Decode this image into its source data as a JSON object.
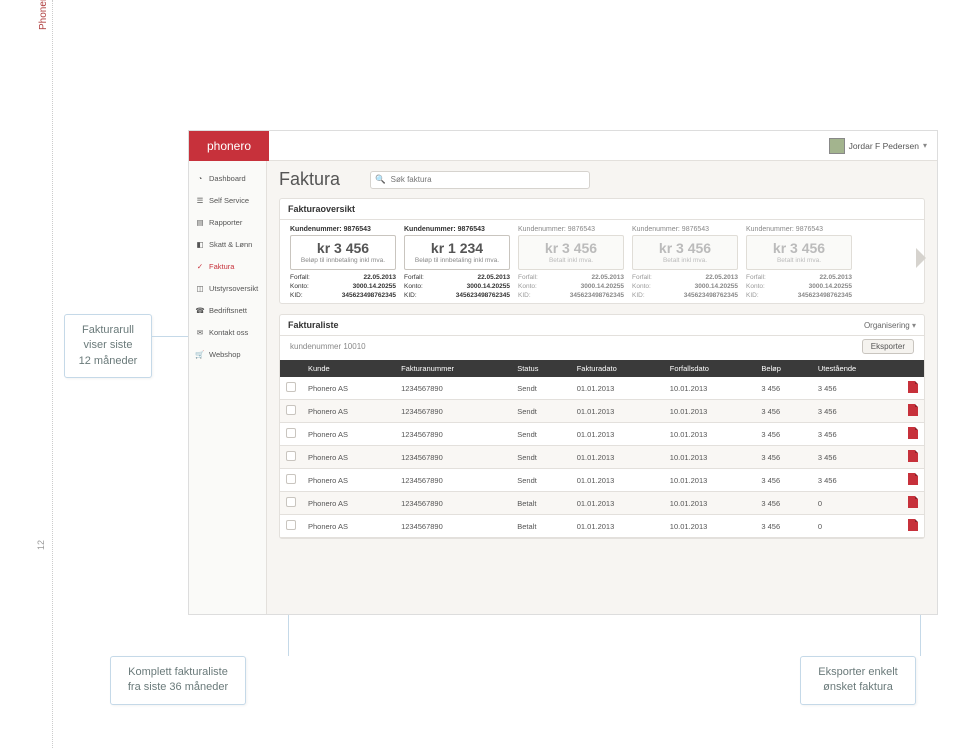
{
  "page": {
    "side_label": "Phonero Bedriftsportal",
    "page_number": "12"
  },
  "callouts": {
    "c1_l1": "Fakturarull",
    "c1_l2": "viser siste",
    "c1_l3": "12 måneder",
    "c2_l1": "Komplett fakturaliste",
    "c2_l2": "fra siste 36 måneder",
    "c3_l1": "Eksporter enkelt",
    "c3_l2": "ønsket faktura"
  },
  "header": {
    "logo": "phonero",
    "user_name": "Jordar F Pedersen"
  },
  "nav": {
    "dashboard": "Dashboard",
    "self_service": "Self Service",
    "rapporter": "Rapporter",
    "skatt": "Skatt & Lønn",
    "faktura": "Faktura",
    "utstyr": "Utstyrsoversikt",
    "bedriftsnett": "Bedriftsnett",
    "kontakt": "Kontakt oss",
    "webshop": "Webshop"
  },
  "main": {
    "title": "Faktura",
    "search_placeholder": "Søk faktura"
  },
  "panel1": {
    "title": "Fakturaoversikt",
    "cards": [
      {
        "kundenr_label": "Kundenummer: 9876543",
        "amount": "kr 3 456",
        "sub": "Beløp til innbetaling inkl mva.",
        "forfall_l": "Forfall:",
        "forfall_v": "22.05.2013",
        "konto_l": "Konto:",
        "konto_v": "3000.14.20255",
        "kid_l": "KID:",
        "kid_v": "345623498762345",
        "active": true
      },
      {
        "kundenr_label": "Kundenummer: 9876543",
        "amount": "kr 1 234",
        "sub": "Beløp til innbetaling inkl mva.",
        "forfall_l": "Forfall:",
        "forfall_v": "22.05.2013",
        "konto_l": "Konto:",
        "konto_v": "3000.14.20255",
        "kid_l": "KID:",
        "kid_v": "345623498762345",
        "active": true
      },
      {
        "kundenr_label": "Kundenummer: 9876543",
        "amount": "kr 3 456",
        "sub": "Betalt inkl mva.",
        "forfall_l": "Forfall:",
        "forfall_v": "22.05.2013",
        "konto_l": "Konto:",
        "konto_v": "3000.14.20255",
        "kid_l": "KID:",
        "kid_v": "345623498762345",
        "active": false
      },
      {
        "kundenr_label": "Kundenummer: 9876543",
        "amount": "kr 3 456",
        "sub": "Betalt inkl mva.",
        "forfall_l": "Forfall:",
        "forfall_v": "22.05.2013",
        "konto_l": "Konto:",
        "konto_v": "3000.14.20255",
        "kid_l": "KID:",
        "kid_v": "345623498762345",
        "active": false
      },
      {
        "kundenr_label": "Kundenummer: 9876543",
        "amount": "kr 3 456",
        "sub": "Betalt inkl mva.",
        "forfall_l": "Forfall:",
        "forfall_v": "22.05.2013",
        "konto_l": "Konto:",
        "konto_v": "3000.14.20255",
        "kid_l": "KID:",
        "kid_v": "345623498762345",
        "active": false
      }
    ]
  },
  "panel2": {
    "title": "Fakturaliste",
    "organisering": "Organisering",
    "sub_label": "kundenummer 10010",
    "export_btn": "Eksporter",
    "columns": {
      "kunde": "Kunde",
      "nr": "Fakturanummer",
      "status": "Status",
      "dato": "Fakturadato",
      "forfall": "Forfallsdato",
      "belop": "Beløp",
      "utest": "Utestående"
    },
    "rows": [
      {
        "kunde": "Phonero AS",
        "nr": "1234567890",
        "status": "Sendt",
        "dato": "01.01.2013",
        "forfall": "10.01.2013",
        "belop": "3 456",
        "utest": "3 456"
      },
      {
        "kunde": "Phonero AS",
        "nr": "1234567890",
        "status": "Sendt",
        "dato": "01.01.2013",
        "forfall": "10.01.2013",
        "belop": "3 456",
        "utest": "3 456"
      },
      {
        "kunde": "Phonero AS",
        "nr": "1234567890",
        "status": "Sendt",
        "dato": "01.01.2013",
        "forfall": "10.01.2013",
        "belop": "3 456",
        "utest": "3 456"
      },
      {
        "kunde": "Phonero AS",
        "nr": "1234567890",
        "status": "Sendt",
        "dato": "01.01.2013",
        "forfall": "10.01.2013",
        "belop": "3 456",
        "utest": "3 456"
      },
      {
        "kunde": "Phonero AS",
        "nr": "1234567890",
        "status": "Sendt",
        "dato": "01.01.2013",
        "forfall": "10.01.2013",
        "belop": "3 456",
        "utest": "3 456"
      },
      {
        "kunde": "Phonero AS",
        "nr": "1234567890",
        "status": "Betalt",
        "dato": "01.01.2013",
        "forfall": "10.01.2013",
        "belop": "3 456",
        "utest": "0"
      },
      {
        "kunde": "Phonero AS",
        "nr": "1234567890",
        "status": "Betalt",
        "dato": "01.01.2013",
        "forfall": "10.01.2013",
        "belop": "3 456",
        "utest": "0"
      }
    ]
  }
}
